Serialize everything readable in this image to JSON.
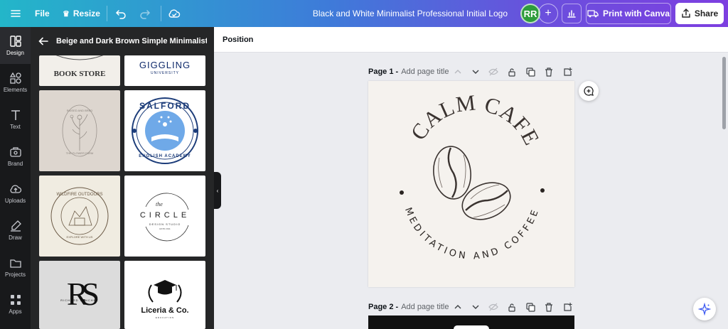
{
  "topbar": {
    "file_label": "File",
    "resize_label": "Resize",
    "document_title": "Black and White Minimalist Professional Initial Logo",
    "avatar_initials": "RR",
    "print_label": "Print with Canva",
    "share_label": "Share",
    "gradient_colors": [
      "#23b6c9",
      "#3e7bd9",
      "#7d3fe0"
    ]
  },
  "rail": {
    "items": [
      {
        "label": "Design",
        "icon": "design-icon"
      },
      {
        "label": "Elements",
        "icon": "elements-icon"
      },
      {
        "label": "Text",
        "icon": "text-icon"
      },
      {
        "label": "Brand",
        "icon": "brand-icon"
      },
      {
        "label": "Uploads",
        "icon": "uploads-icon"
      },
      {
        "label": "Draw",
        "icon": "draw-icon"
      },
      {
        "label": "Projects",
        "icon": "projects-icon"
      },
      {
        "label": "Apps",
        "icon": "apps-icon"
      }
    ]
  },
  "panel": {
    "title": "Beige and Dark Brown Simple Minimalist ...",
    "thumbnails": {
      "bookstore": "BOOK STORE",
      "giggling": "GIGGLING",
      "giggling_sub": "UNIVERSITY",
      "botanical_text": "RAISED AND BRED",
      "botanical_sub": "THE FLOWER FARM",
      "salford_top": "SALFORD",
      "salford_bottom": "ENGLISH ACADEMY",
      "wildfire_top": "WILDFIRE OUTDOORS",
      "wildfire_bottom": "EXPLORE WITH US",
      "circle_the": "the",
      "circle_main": "CIRCLE",
      "circle_sub": "DESIGN STUDIO",
      "circle_est": "ESTD 2011",
      "monogram": "RS",
      "monogram_name": "RICHARD SANCHEZ",
      "liceria": "Liceria & Co.",
      "liceria_sub": "EDUCATION"
    }
  },
  "context_bar": {
    "position_label": "Position"
  },
  "pages": [
    {
      "number_label": "Page 1 -",
      "title_placeholder": "Add page title"
    },
    {
      "number_label": "Page 2 -",
      "title_placeholder": "Add page title"
    }
  ],
  "logo": {
    "title": "CALM CAFE",
    "subtitle": "MEDITATION AND COFFEE",
    "background": "#f5f2ee",
    "ink": "#3a3330"
  }
}
